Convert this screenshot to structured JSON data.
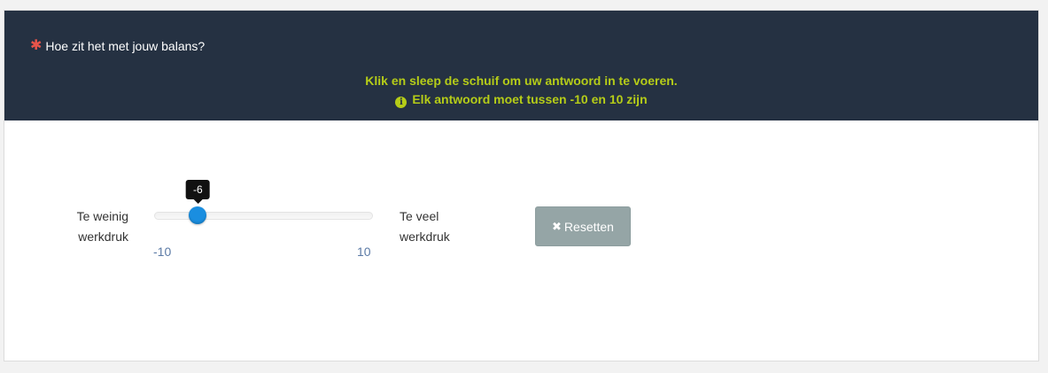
{
  "question": {
    "required_marker": "✱",
    "text": "Hoe zit het met jouw balans?"
  },
  "instructions": {
    "line1": "Klik en sleep de schuif om uw antwoord in te voeren.",
    "line2": "Elk antwoord moet tussen -10 en 10 zijn",
    "info_icon": "info-icon"
  },
  "slider": {
    "label_left_line1": "Te weinig",
    "label_left_line2": "werkdruk",
    "label_right_line1": "Te veel",
    "label_right_line2": "werkdruk",
    "min": -10,
    "max": 10,
    "value": -6,
    "min_label": "-10",
    "max_label": "10",
    "tooltip": "-6"
  },
  "reset_button": {
    "icon": "x-icon",
    "label": "Resetten"
  },
  "colors": {
    "header_bg": "#253142",
    "instruction_text": "#b5cc18",
    "required_marker": "#e8544a",
    "slider_handle": "#1a8ee0",
    "reset_button_bg": "#95a5a6"
  }
}
